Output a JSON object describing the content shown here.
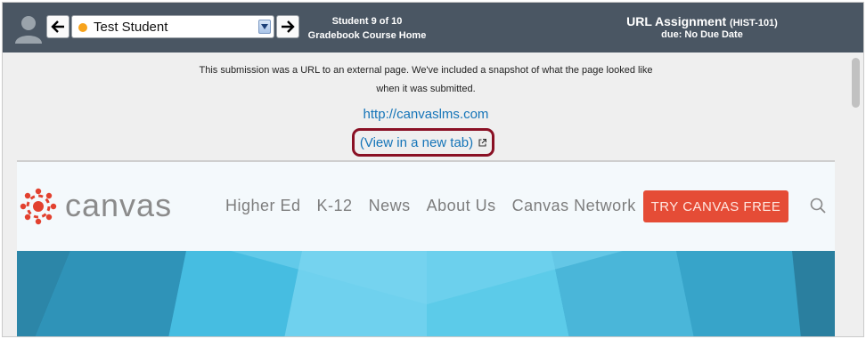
{
  "toolbar": {
    "student_name": "Test Student",
    "student_count": "Student 9 of 10",
    "gradebook_link": "Gradebook Course Home",
    "assignment_title": "URL Assignment",
    "assignment_code": "(HIST-101)",
    "due": "due: No Due Date",
    "status_color": "#f7a31c"
  },
  "submission": {
    "notice_line1": "This submission was a URL to an external page. We've included a snapshot of what the page looked like",
    "notice_line2": "when it was submitted.",
    "url": "http://canvaslms.com",
    "view_new_tab": "(View in a new tab)"
  },
  "snapshot": {
    "logo_text": "canvas",
    "nav": [
      "Higher Ed",
      "K-12",
      "News",
      "About Us",
      "Canvas Network"
    ],
    "cta": "TRY CANVAS FREE",
    "cta_color": "#e54c36"
  },
  "icons": [
    "avatar-icon",
    "arrow-left-icon",
    "arrow-right-icon",
    "chevron-down-icon",
    "external-link-icon",
    "canvas-logo-icon",
    "search-icon"
  ]
}
